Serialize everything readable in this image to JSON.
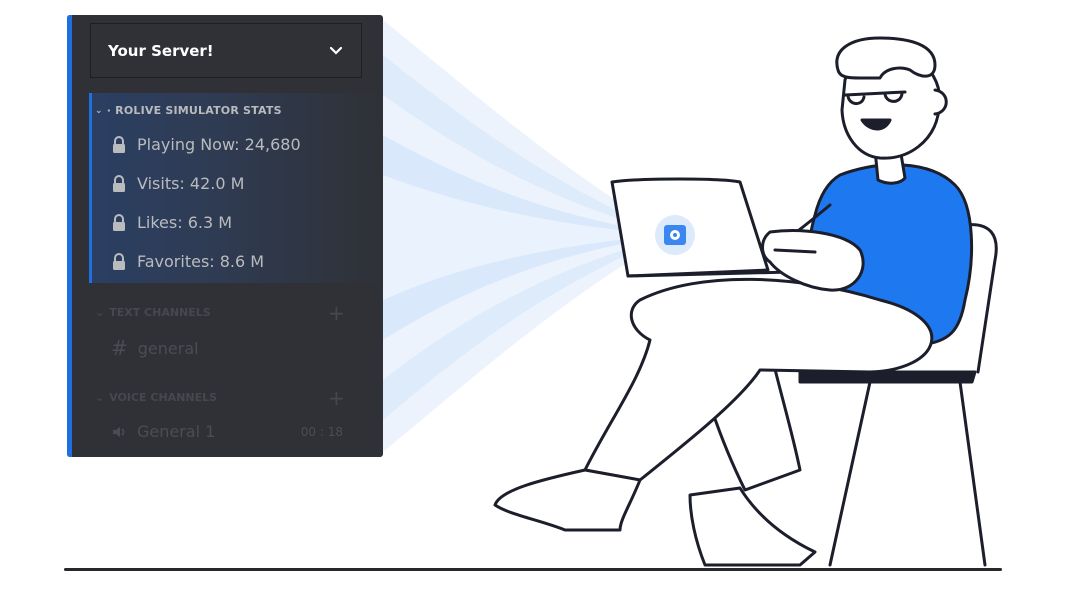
{
  "server": {
    "name": "Your Server!",
    "menu_icon": "chevron-down-icon"
  },
  "categories": {
    "stats": {
      "title": "· ROLIVE SIMULATOR STATS",
      "items": [
        {
          "label": "Playing Now: 24,680",
          "icon": "lock-icon"
        },
        {
          "label": "Visits: 42.0 M",
          "icon": "lock-icon"
        },
        {
          "label": "Likes: 6.3 M",
          "icon": "lock-icon"
        },
        {
          "label": "Favorites: 8.6 M",
          "icon": "lock-icon"
        }
      ]
    },
    "text": {
      "title": "TEXT CHANNELS",
      "channel": "general"
    },
    "voice": {
      "title": "VOICE CHANNELS",
      "channel": "General 1",
      "timer": "00 : 18"
    }
  },
  "colors": {
    "accent": "#1f6fe0",
    "panel": "#2f3136",
    "shirt": "#1e78f0",
    "outline": "#1c1f2b",
    "beam": "#d4e6fb"
  }
}
